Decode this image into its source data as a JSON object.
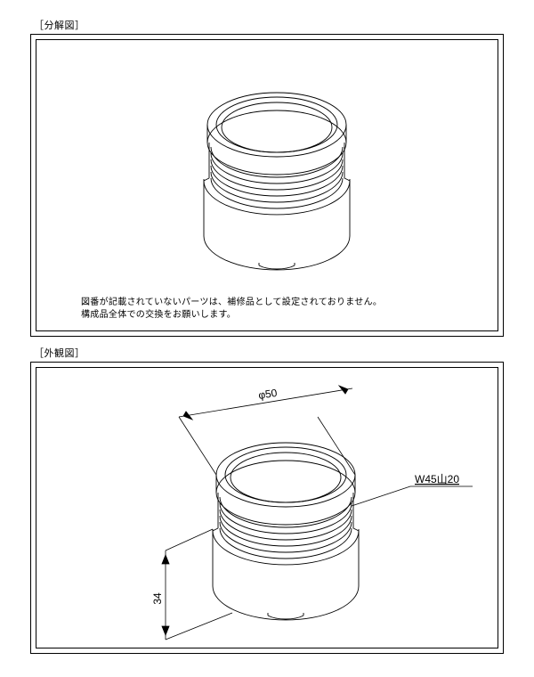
{
  "sections": {
    "exploded": {
      "title": "［分解図］",
      "note_line1": "図番が記載されていないパーツは、補修品として設定されておりません。",
      "note_line2": "構成品全体での交換をお願いします。"
    },
    "external": {
      "title": "［外観図］",
      "dimensions": {
        "diameter_label": "φ50",
        "thread_label": "W45山20",
        "height_label": "34"
      }
    }
  },
  "part": {
    "diameter": 50,
    "height": 34,
    "thread_spec": "W45山20"
  }
}
